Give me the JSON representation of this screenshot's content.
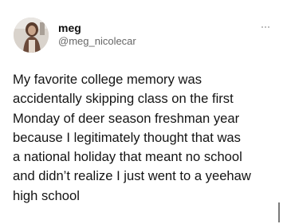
{
  "tweet": {
    "display_name": "meg",
    "handle": "@meg_nicolecar",
    "text_lines": [
      "My favorite college memory was",
      "accidentally skipping class on the first",
      "Monday of deer season freshman year",
      "because I legitimately thought that was",
      "a national holiday that meant no school",
      "and didn’t realize I just went to a yeehaw",
      "high school"
    ]
  },
  "icons": {
    "more": "more-horizontal-icon",
    "avatar": "profile-photo"
  }
}
